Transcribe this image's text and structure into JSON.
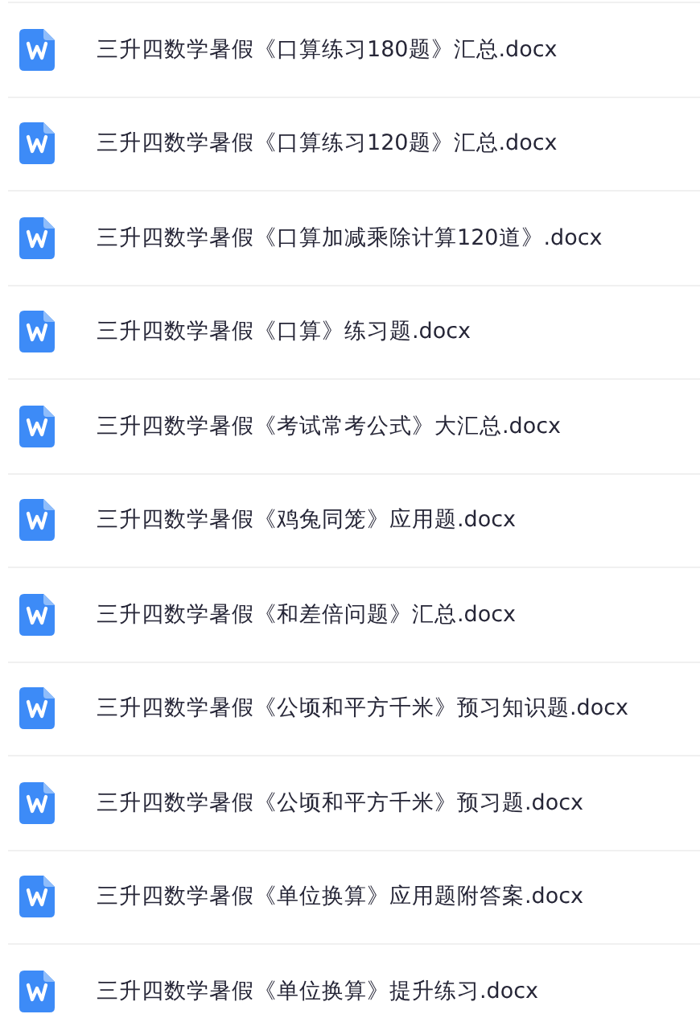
{
  "files": [
    {
      "name": "三升四数学暑假《口算练习180题》汇总.docx"
    },
    {
      "name": "三升四数学暑假《口算练习120题》汇总.docx"
    },
    {
      "name": "三升四数学暑假《口算加减乘除计算120道》.docx"
    },
    {
      "name": "三升四数学暑假《口算》练习题.docx"
    },
    {
      "name": "三升四数学暑假《考试常考公式》大汇总.docx"
    },
    {
      "name": "三升四数学暑假《鸡兔同笼》应用题.docx"
    },
    {
      "name": "三升四数学暑假《和差倍问题》汇总.docx"
    },
    {
      "name": "三升四数学暑假《公顷和平方千米》预习知识题.docx"
    },
    {
      "name": "三升四数学暑假《公顷和平方千米》预习题.docx"
    },
    {
      "name": "三升四数学暑假《单位换算》应用题附答案.docx"
    },
    {
      "name": "三升四数学暑假《单位换算》提升练习.docx"
    }
  ]
}
